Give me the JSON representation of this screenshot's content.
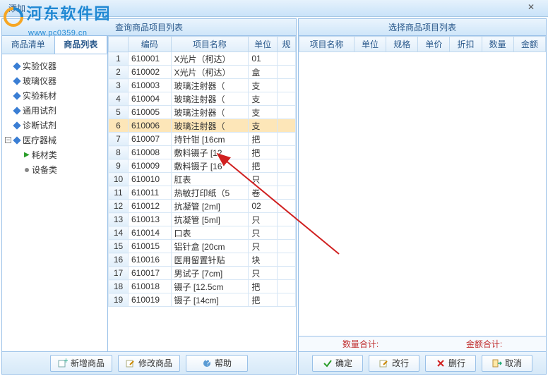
{
  "window": {
    "title": "添加"
  },
  "logo": {
    "text": "河东软件园",
    "url": "www.pc0359.cn"
  },
  "left": {
    "header": "查询商品项目列表",
    "tabs": [
      {
        "label": "商品清单",
        "active": false
      },
      {
        "label": "商品列表",
        "active": true
      }
    ],
    "tree": [
      {
        "label": "实验仪器",
        "level": 0,
        "icon": "diamond"
      },
      {
        "label": "玻璃仪器",
        "level": 0,
        "icon": "diamond"
      },
      {
        "label": "实验耗材",
        "level": 0,
        "icon": "diamond"
      },
      {
        "label": "通用试剂",
        "level": 0,
        "icon": "diamond"
      },
      {
        "label": "诊断试剂",
        "level": 0,
        "icon": "diamond"
      },
      {
        "label": "医疗器械",
        "level": 0,
        "icon": "diamond",
        "expander": "minus"
      },
      {
        "label": "耗材类",
        "level": 1,
        "icon": "arrow"
      },
      {
        "label": "设备类",
        "level": 1,
        "icon": "dot"
      }
    ],
    "columns": [
      "",
      "编码",
      "项目名称",
      "单位",
      "规"
    ],
    "rows": [
      {
        "n": 1,
        "code": "610001",
        "name": "X光片（柯达）",
        "unit": "01"
      },
      {
        "n": 2,
        "code": "610002",
        "name": "X光片（柯达）",
        "unit": "盒"
      },
      {
        "n": 3,
        "code": "610003",
        "name": "玻璃注射器（",
        "unit": "支"
      },
      {
        "n": 4,
        "code": "610004",
        "name": "玻璃注射器（",
        "unit": "支"
      },
      {
        "n": 5,
        "code": "610005",
        "name": "玻璃注射器（",
        "unit": "支"
      },
      {
        "n": 6,
        "code": "610006",
        "name": "玻璃注射器（",
        "unit": "支",
        "selected": true
      },
      {
        "n": 7,
        "code": "610007",
        "name": "持针钳 [16cm",
        "unit": "把"
      },
      {
        "n": 8,
        "code": "610008",
        "name": "敷料镊子 [12",
        "unit": "把"
      },
      {
        "n": 9,
        "code": "610009",
        "name": "敷料镊子 [16",
        "unit": "把"
      },
      {
        "n": 10,
        "code": "610010",
        "name": "肛表",
        "unit": "只"
      },
      {
        "n": 11,
        "code": "610011",
        "name": "热敏打印纸（5",
        "unit": "卷"
      },
      {
        "n": 12,
        "code": "610012",
        "name": "抗凝管 [2ml]",
        "unit": "02"
      },
      {
        "n": 13,
        "code": "610013",
        "name": "抗凝管 [5ml]",
        "unit": "只"
      },
      {
        "n": 14,
        "code": "610014",
        "name": "口表",
        "unit": "只"
      },
      {
        "n": 15,
        "code": "610015",
        "name": "铝针盒 [20cm",
        "unit": "只"
      },
      {
        "n": 16,
        "code": "610016",
        "name": "医用留置针贴",
        "unit": "块"
      },
      {
        "n": 17,
        "code": "610017",
        "name": "男试子 [7cm]",
        "unit": "只"
      },
      {
        "n": 18,
        "code": "610018",
        "name": "镊子 [12.5cm",
        "unit": "把"
      },
      {
        "n": 19,
        "code": "610019",
        "name": "镊子 [14cm]",
        "unit": "把"
      }
    ],
    "buttons": {
      "add": "新增商品",
      "edit": "修改商品",
      "help": "帮助"
    }
  },
  "right": {
    "header": "选择商品项目列表",
    "columns": [
      "项目名称",
      "单位",
      "规格",
      "单价",
      "折扣",
      "数量",
      "金额"
    ],
    "summary": {
      "qty_label": "数量合计:",
      "amt_label": "金额合计:"
    },
    "buttons": {
      "ok": "确定",
      "modify": "改行",
      "delete": "删行",
      "cancel": "取消"
    }
  }
}
